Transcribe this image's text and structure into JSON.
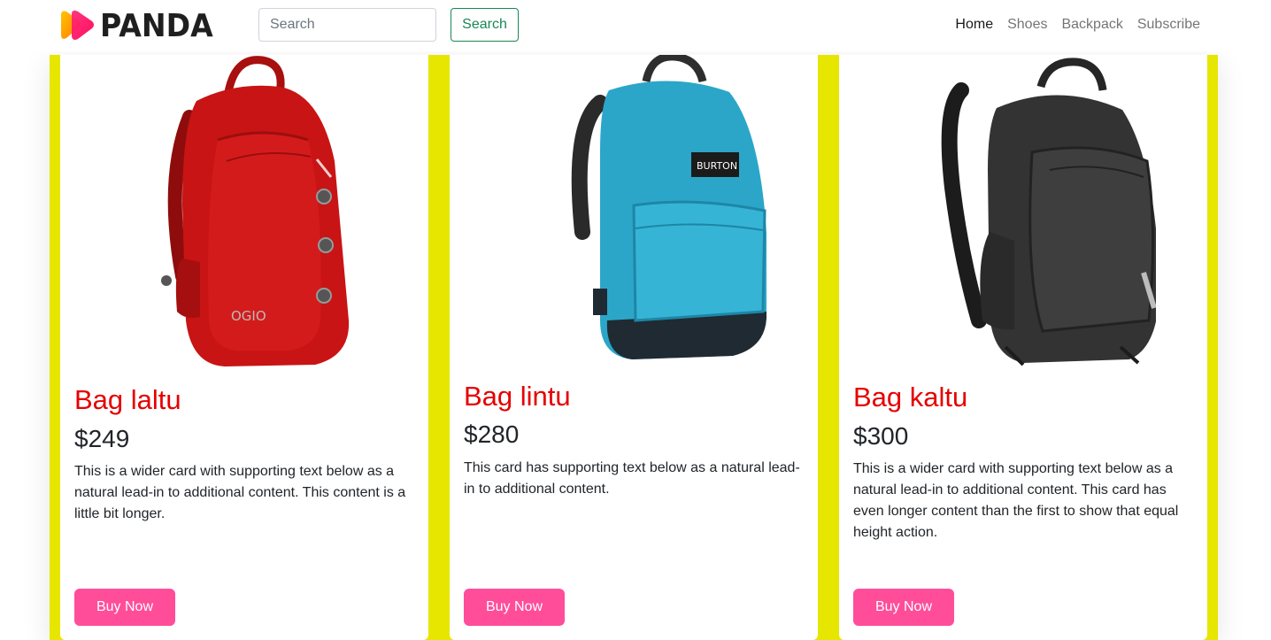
{
  "colors": {
    "accent_title": "#e60000",
    "buy_button": "#ff4d9a",
    "yellow_bg": "#e6e600",
    "search_green": "#198754"
  },
  "navbar": {
    "brand": "PANDA",
    "search_placeholder": "Search",
    "search_button": "Search",
    "links": [
      {
        "label": "Home",
        "active": true
      },
      {
        "label": "Shoes",
        "active": false
      },
      {
        "label": "Backpack",
        "active": false
      },
      {
        "label": "Subscribe",
        "active": false
      }
    ]
  },
  "cards": [
    {
      "image": "red-backpack-image",
      "title": "Bag laltu",
      "price": "$249",
      "text": "This is a wider card with supporting text below as a natural lead-in to additional content. This content is a little bit longer.",
      "button": "Buy Now"
    },
    {
      "image": "blue-backpack-image",
      "title": "Bag lintu",
      "price": "$280",
      "text": "This card has supporting text below as a natural lead-in to additional content.",
      "button": "Buy Now"
    },
    {
      "image": "black-backpack-image",
      "title": "Bag kaltu",
      "price": "$300",
      "text": "This is a wider card with supporting text below as a natural lead-in to additional content. This card has even longer content than the first to show that equal height action.",
      "button": "Buy Now"
    }
  ]
}
